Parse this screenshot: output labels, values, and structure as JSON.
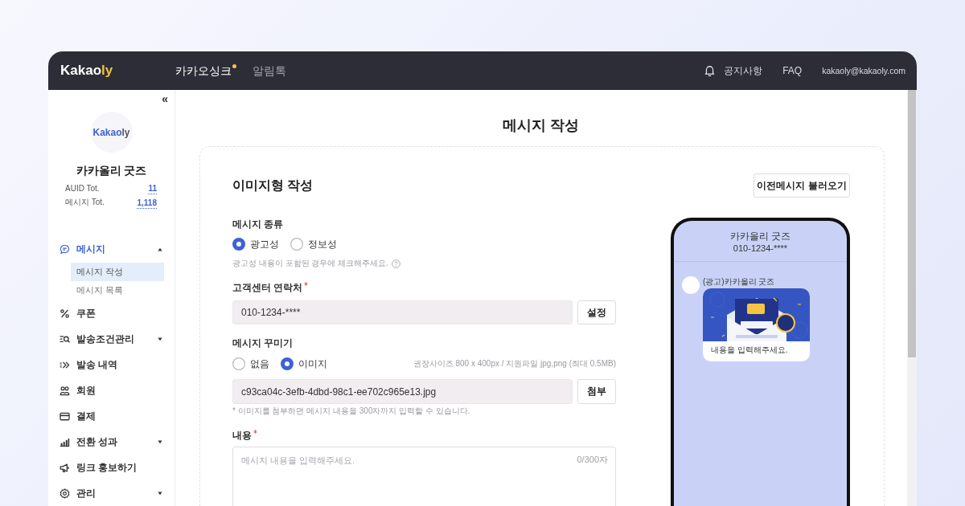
{
  "header": {
    "logo": {
      "text": "Kakao",
      "accent": "ly"
    },
    "tabs": [
      {
        "label": "카카오싱크",
        "selected": true,
        "dot": true
      },
      {
        "label": "알림톡",
        "selected": false,
        "dot": false
      }
    ],
    "links": [
      "공지사항",
      "FAQ"
    ],
    "account": "kakaoly@kakaoly.com"
  },
  "sidebar": {
    "collapse": "«",
    "logo": {
      "text": "Kakao",
      "accent": "ly"
    },
    "shop_name": "카카올리 굿즈",
    "stats": [
      {
        "label": "AUID Tot.",
        "value": "11"
      },
      {
        "label": "메시지 Tot.",
        "value": "1,118"
      }
    ],
    "menu": [
      {
        "label": "메시지",
        "kind": "group",
        "selected": true,
        "expanded": true,
        "children": [
          {
            "label": "메시지 작성",
            "selected": true
          },
          {
            "label": "메시지 목록",
            "selected": false
          }
        ]
      },
      {
        "label": "쿠폰",
        "kind": "link",
        "selected": false
      },
      {
        "label": "발송조건관리",
        "kind": "group",
        "selected": false,
        "expanded": false
      },
      {
        "label": "발송 내역",
        "kind": "link",
        "selected": false
      },
      {
        "label": "회원",
        "kind": "link",
        "selected": false
      },
      {
        "label": "결제",
        "kind": "link",
        "selected": false
      },
      {
        "label": "전환 성과",
        "kind": "group",
        "selected": false,
        "expanded": false
      },
      {
        "label": "링크 홍보하기",
        "kind": "link",
        "selected": false
      },
      {
        "label": "관리",
        "kind": "group",
        "selected": false,
        "expanded": false
      }
    ]
  },
  "page_title": "메시지 작성",
  "form": {
    "title": "이미지형 작성",
    "load_button": "이전메시지 불러오기",
    "message_type": {
      "label": "메시지 종류",
      "options": [
        {
          "label": "광고성",
          "selected": true
        },
        {
          "label": "정보성",
          "selected": false
        }
      ],
      "hint": "광고성 내용이 포함된 경우에 체크해주세요."
    },
    "contact": {
      "label": "고객센터 연락처",
      "required": true,
      "value": "010-1234-****",
      "button": "설정"
    },
    "decoration": {
      "label": "메시지 꾸미기",
      "options": [
        {
          "label": "없음",
          "selected": false
        },
        {
          "label": "이미지",
          "selected": true
        }
      ],
      "spec": "권장사이즈 800 x 400px / 지원파일 jpg,png (최대 0.5MB)",
      "file": "c93ca04c-3efb-4dbd-98c1-ee702c965e13.jpg",
      "button": "첨부",
      "note": "* 이미지를 첨부하면 메시지 내용을 300자까지 입력할 수 있습니다."
    },
    "content": {
      "label": "내용",
      "required": true,
      "placeholder": "메시지 내용을 입력해주세요.",
      "counter": "0/300자"
    }
  },
  "preview": {
    "title": "카카올리 굿즈",
    "phone": "010-1234-****",
    "sender": "(광고)카카올리 굿즈",
    "bubble_text": "내용을 입력해주세요."
  }
}
